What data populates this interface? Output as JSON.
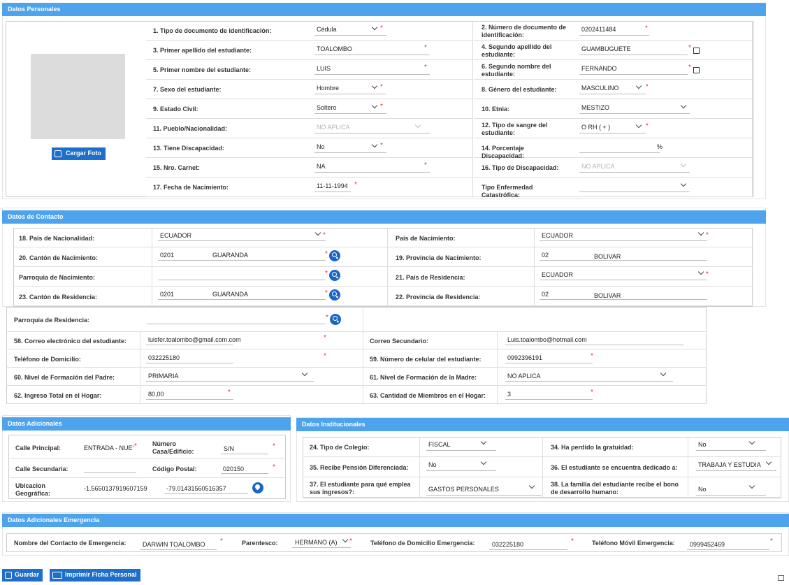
{
  "sections": {
    "personales": "Datos Personales",
    "contacto": "Datos de Contacto",
    "adicionales": "Datos Adicionales",
    "institucionales": "Datos Institucionales",
    "emergencia": "Datos Adicionales Emergencia"
  },
  "photo_button": "Cargar Foto",
  "personales_left": [
    {
      "label": "1. Tipo de documento de identificación:",
      "value": "Cédula",
      "kind": "select",
      "req": true
    },
    {
      "label": "3. Primer apellido del estudiante:",
      "value": "TOALOMBO",
      "kind": "text",
      "req": true
    },
    {
      "label": "5. Primer nombre del estudiante:",
      "value": "LUIS",
      "kind": "text",
      "req": true
    },
    {
      "label": "7. Sexo del estudiante:",
      "value": "Hombre",
      "kind": "select",
      "req": true
    },
    {
      "label": "9. Estado Civil:",
      "value": "Soltero",
      "kind": "select",
      "req": true
    },
    {
      "label": "11. Pueblo/Nacionalidad:",
      "value": "NO APLICA",
      "kind": "select-dis",
      "req": false
    },
    {
      "label": "13. Tiene Discapacidad:",
      "value": "No",
      "kind": "select",
      "req": true
    },
    {
      "label": "15. Nro. Carnet:",
      "value": "NA",
      "kind": "text",
      "req": true
    },
    {
      "label": "17. Fecha de Nacimiento:",
      "value": "11-11-1994",
      "kind": "date",
      "req": true
    }
  ],
  "personales_right": [
    {
      "label": "2. Número de documento de identificación:",
      "value": "0202411484",
      "kind": "text",
      "req": true
    },
    {
      "label": "4. Segundo apellido del estudiante:",
      "value": "GUAMBUGUETE",
      "kind": "text-cb",
      "req": true
    },
    {
      "label": "6. Segundo nombre del estudiante:",
      "value": "FERNANDO",
      "kind": "text-cb",
      "req": true
    },
    {
      "label": "8. Género del estudiante:",
      "value": "MASCULINO",
      "kind": "select",
      "req": true
    },
    {
      "label": "10. Etnia:",
      "value": "MESTIZO",
      "kind": "select-wide",
      "req": false
    },
    {
      "label": "12. Tipo de sangre del estudiante:",
      "value": "O RH ( + )",
      "kind": "select",
      "req": true
    },
    {
      "label": "14. Porcentaje Discapacidad:",
      "value": "",
      "suffix": "%",
      "kind": "pct",
      "req": false
    },
    {
      "label": "16. Tipo de Discapacidad:",
      "value": "NO APLICA",
      "kind": "select-wide-dis",
      "req": false
    },
    {
      "label": "Tipo Enfermedad Catastrófica:",
      "value": "",
      "kind": "select-wide",
      "req": false
    }
  ],
  "contacto_a": [
    {
      "l_label": "18. País de Nacionalidad:",
      "l_code": "ECUADOR",
      "l_name": "",
      "l_kind": "select",
      "r_label": "País de Nacimiento:",
      "r_code": "ECUADOR",
      "r_name": "",
      "r_kind": "select"
    },
    {
      "l_label": "20. Cantón de Nacimiento:",
      "l_code": "0201",
      "l_name": "GUARANDA",
      "l_kind": "search",
      "r_label": "19. Provincia de Nacimiento:",
      "r_code": "02",
      "r_name": "BOLIVAR",
      "r_kind": "text"
    },
    {
      "l_label": "Parroquia de Nacimiento:",
      "l_code": "",
      "l_name": "",
      "l_kind": "search",
      "r_label": "21. País de Residencia:",
      "r_code": "ECUADOR",
      "r_name": "",
      "r_kind": "select"
    },
    {
      "l_label": "23. Cantón de Residencia:",
      "l_code": "0201",
      "l_name": "GUARANDA",
      "l_kind": "search",
      "r_label": "22. Provincia de Residencia:",
      "r_code": "02",
      "r_name": "BOLIVAR",
      "r_kind": "text"
    }
  ],
  "contacto_b": {
    "parroquia_label": "Parroquia de Residencia:",
    "rows": [
      {
        "l_label": "58. Correo electrónico del estudiante:",
        "l_value": "luisfer.toalombo@gmail.com.com",
        "l_kind": "text-req",
        "r_label": "Correo Secundario:",
        "r_value": "Luis.toalombo@hotmail.com",
        "r_kind": "text"
      },
      {
        "l_label": "Teléfono de Domicilio:",
        "l_value": "032225180",
        "l_kind": "text-req",
        "r_label": "59. Número de celular del estudiante:",
        "r_value": "0992396191",
        "r_kind": "text-req"
      },
      {
        "l_label": "60. Nivel de Formación del Padre:",
        "l_value": "PRIMARIA",
        "l_kind": "select",
        "r_label": "61. Nivel de Formación de la Madre:",
        "r_value": "NO APLICA",
        "r_kind": "select"
      },
      {
        "l_label": "62. Ingreso Total en el Hogar:",
        "l_value": "80,00",
        "l_kind": "text-req",
        "r_label": "63. Cantidad de Miembros en el Hogar:",
        "r_value": "3",
        "r_kind": "text-req"
      }
    ]
  },
  "adicionales": {
    "calle_principal_label": "Calle Principal:",
    "calle_principal": "ENTRADA - NUE'",
    "numero_label": "Número Casa/Edificio:",
    "numero": "S/N",
    "calle_secundaria_label": "Calle Secundaria:",
    "calle_secundaria": "",
    "codigo_postal_label": "Código Postal:",
    "codigo_postal": "020150",
    "ubicacion_label": "Ubicacion Geográfica:",
    "latitud": "-1.5650137919607159",
    "longitud": "-79.01431560516357"
  },
  "institucionales": [
    {
      "l_label": "24. Tipo de Colegio:",
      "l_value": "FISCAL",
      "r_label": "34. Ha perdido la gratuidad:",
      "r_value": "No"
    },
    {
      "l_label": "35. Recibe Pensión Diferenciada:",
      "l_value": "No",
      "r_label": "36. El estudiante se encuentra dedicado a:",
      "r_value": "TRABAJA Y ESTUDIA"
    },
    {
      "l_label": "37. El estudiante para qué emplea sus ingresos?:",
      "l_value": "GASTOS PERSONALES",
      "r_label": "38. La familia del estudiante recibe el bono de desarrollo humano:",
      "r_value": "No"
    }
  ],
  "emergencia": {
    "contacto_label": "Nombre del Contacto de Emergencia:",
    "contacto": "DARWIN TOALOMBO",
    "parentesco_label": "Parentesco:",
    "parentesco": "HERMANO (A)",
    "tel_dom_label": "Teléfono de Domicilio Emergencia:",
    "tel_dom": "032225180",
    "tel_movil_label": "Teléfono Móvil Emergencia:",
    "tel_movil": "0999452469"
  },
  "buttons": {
    "guardar": "Guardar",
    "imprimir": "Imprimir Ficha Personal"
  }
}
